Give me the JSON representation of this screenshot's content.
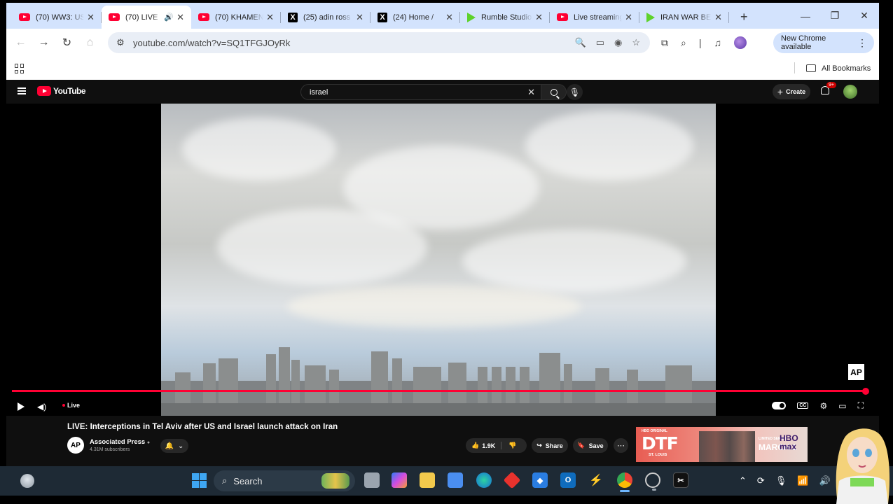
{
  "browser": {
    "tabs": [
      {
        "title": "(70) WW3: US",
        "favicon": "youtube",
        "active": false
      },
      {
        "title": "(70) LIVE",
        "favicon": "youtube",
        "active": true,
        "audio": true
      },
      {
        "title": "(70) KHAMEN",
        "favicon": "youtube",
        "active": false
      },
      {
        "title": "(25) adin ross",
        "favicon": "x",
        "active": false
      },
      {
        "title": "(24) Home /",
        "favicon": "x",
        "active": false
      },
      {
        "title": "Rumble Studio",
        "favicon": "rumble",
        "active": false
      },
      {
        "title": "Live streaming",
        "favicon": "youtube",
        "active": false
      },
      {
        "title": "IRAN WAR BE",
        "favicon": "rumble",
        "active": false
      }
    ],
    "url": "youtube.com/watch?v=SQ1TFGJOyRk",
    "new_chrome_label": "New Chrome available",
    "all_bookmarks_label": "All Bookmarks"
  },
  "youtube": {
    "logo_text": "YouTube",
    "search_value": "israel",
    "create_label": "Create",
    "notification_count": "9+",
    "live_label": "Live",
    "video_title": "LIVE: Interceptions in Tel Aviv after US and Israel launch attack on Iran",
    "channel_name": "Associated Press",
    "channel_avatar_text": "AP",
    "subscribers": "4.31M subscribers",
    "likes": "1.9K",
    "share_label": "Share",
    "save_label": "Save",
    "watermark": "AP",
    "progress": 1.0,
    "ad": {
      "brand_small": "HBO ORIGINAL",
      "title": "DTF",
      "subtitle": "ST. LOUIS",
      "tagline": "LIMITED SERIES",
      "date": "MARCH 1",
      "service": "HBO max"
    }
  },
  "taskbar": {
    "search_label": "Search"
  },
  "colors": {
    "tab_strip": "#d3e3fd",
    "youtube_red": "#ff0033",
    "taskbar": "#1e2a35"
  }
}
